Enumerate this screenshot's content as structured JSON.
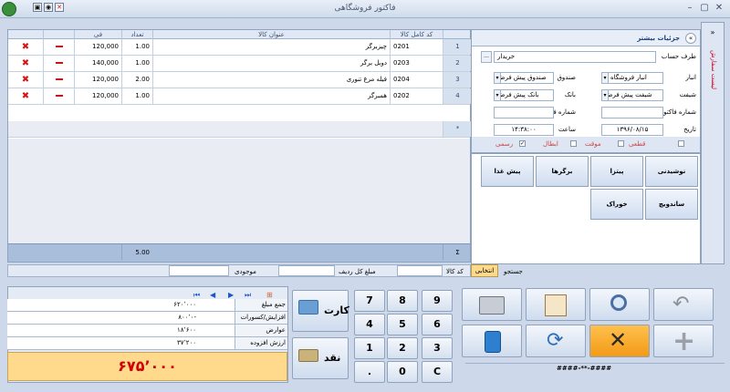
{
  "title": "فاکتور فروشگاهی",
  "grid": {
    "headers": {
      "code": "کد کامل کالا",
      "name": "عنوان کالا",
      "qty": "تعداد",
      "price": "فی"
    },
    "rows": [
      {
        "n": "1",
        "code": "0201",
        "name": "چیزبرگر",
        "qty": "1.00",
        "price": "120,000"
      },
      {
        "n": "2",
        "code": "0203",
        "name": "دوبل برگر",
        "qty": "1.00",
        "price": "140,000"
      },
      {
        "n": "3",
        "code": "0204",
        "name": "فیله مرغ تنوری",
        "qty": "2.00",
        "price": "120,000"
      },
      {
        "n": "4",
        "code": "0202",
        "name": "همبرگر",
        "qty": "1.00",
        "price": "120,000"
      }
    ],
    "new_row_marker": "*",
    "total_qty": "5.00",
    "sum_marker": "Σ"
  },
  "details": {
    "header": "جزئیات بیشتر",
    "side_tab": "لیست سفارش",
    "account_label": "طرف حساب",
    "account_value": "خریدار",
    "warehouse_label": "انبار",
    "warehouse_value": "انبار فروشگاه ۱",
    "cashbox_label": "صندوق",
    "cashbox_value": "صندوق پیش فرض",
    "shift_label": "شیفت",
    "shift_value": "شیفت پیش فرض",
    "bank_label": "بانک",
    "bank_value": "بانک پیش فرض",
    "invoice_no_label": "شماره فاکتور",
    "receipt_no_label": "شماره فیش",
    "date_label": "تاریخ",
    "date_value": "۱۳۹۶/۰۸/۱۵",
    "time_label": "ساعت",
    "time_value": "۱۴:۳۸:۰۰",
    "chk_final": "قطعی",
    "chk_temp": "موقت",
    "chk_cancel": "ابطال",
    "chk_official": "رسمی",
    "search_label": "جستجو",
    "suggestion_tab": "انتخابی"
  },
  "categories": [
    "نوشیدنی",
    "پیتزا",
    "برگرها",
    "پیش غذا",
    "ساندویچ",
    "خوراک"
  ],
  "info_bar": {
    "code_label": "کد کالا",
    "row_total_label": "مبلغ کل ردیف",
    "stock_label": "موجودی"
  },
  "summary": {
    "rows": [
      {
        "label": "جمع مبلغ",
        "value": "۶۲۰٬۰۰۰"
      },
      {
        "label": "افزایش/کسورات",
        "value": "۸۰۰٬۰-"
      },
      {
        "label": "عوارض",
        "value": "۱۸٬۶۰۰"
      },
      {
        "label": "ارزش افزوده",
        "value": "۳۷٬۲۰۰"
      }
    ],
    "total": "۶۷۵٬۰۰۰"
  },
  "keypad": [
    "7",
    "8",
    "9",
    "4",
    "5",
    "6",
    "1",
    "2",
    "3",
    ".",
    "0",
    "C"
  ],
  "payments": {
    "card": "کارت",
    "cash": "نقد"
  },
  "status_mask": "####-**-####",
  "icons": {
    "app": "logo-icon",
    "search": "magnifier-icon",
    "undo": "back-arrow-icon",
    "print": "printer-icon"
  },
  "colors": {
    "accent": "#cdd9ea",
    "highlight": "#ffd98c",
    "total_text": "#d30000"
  }
}
